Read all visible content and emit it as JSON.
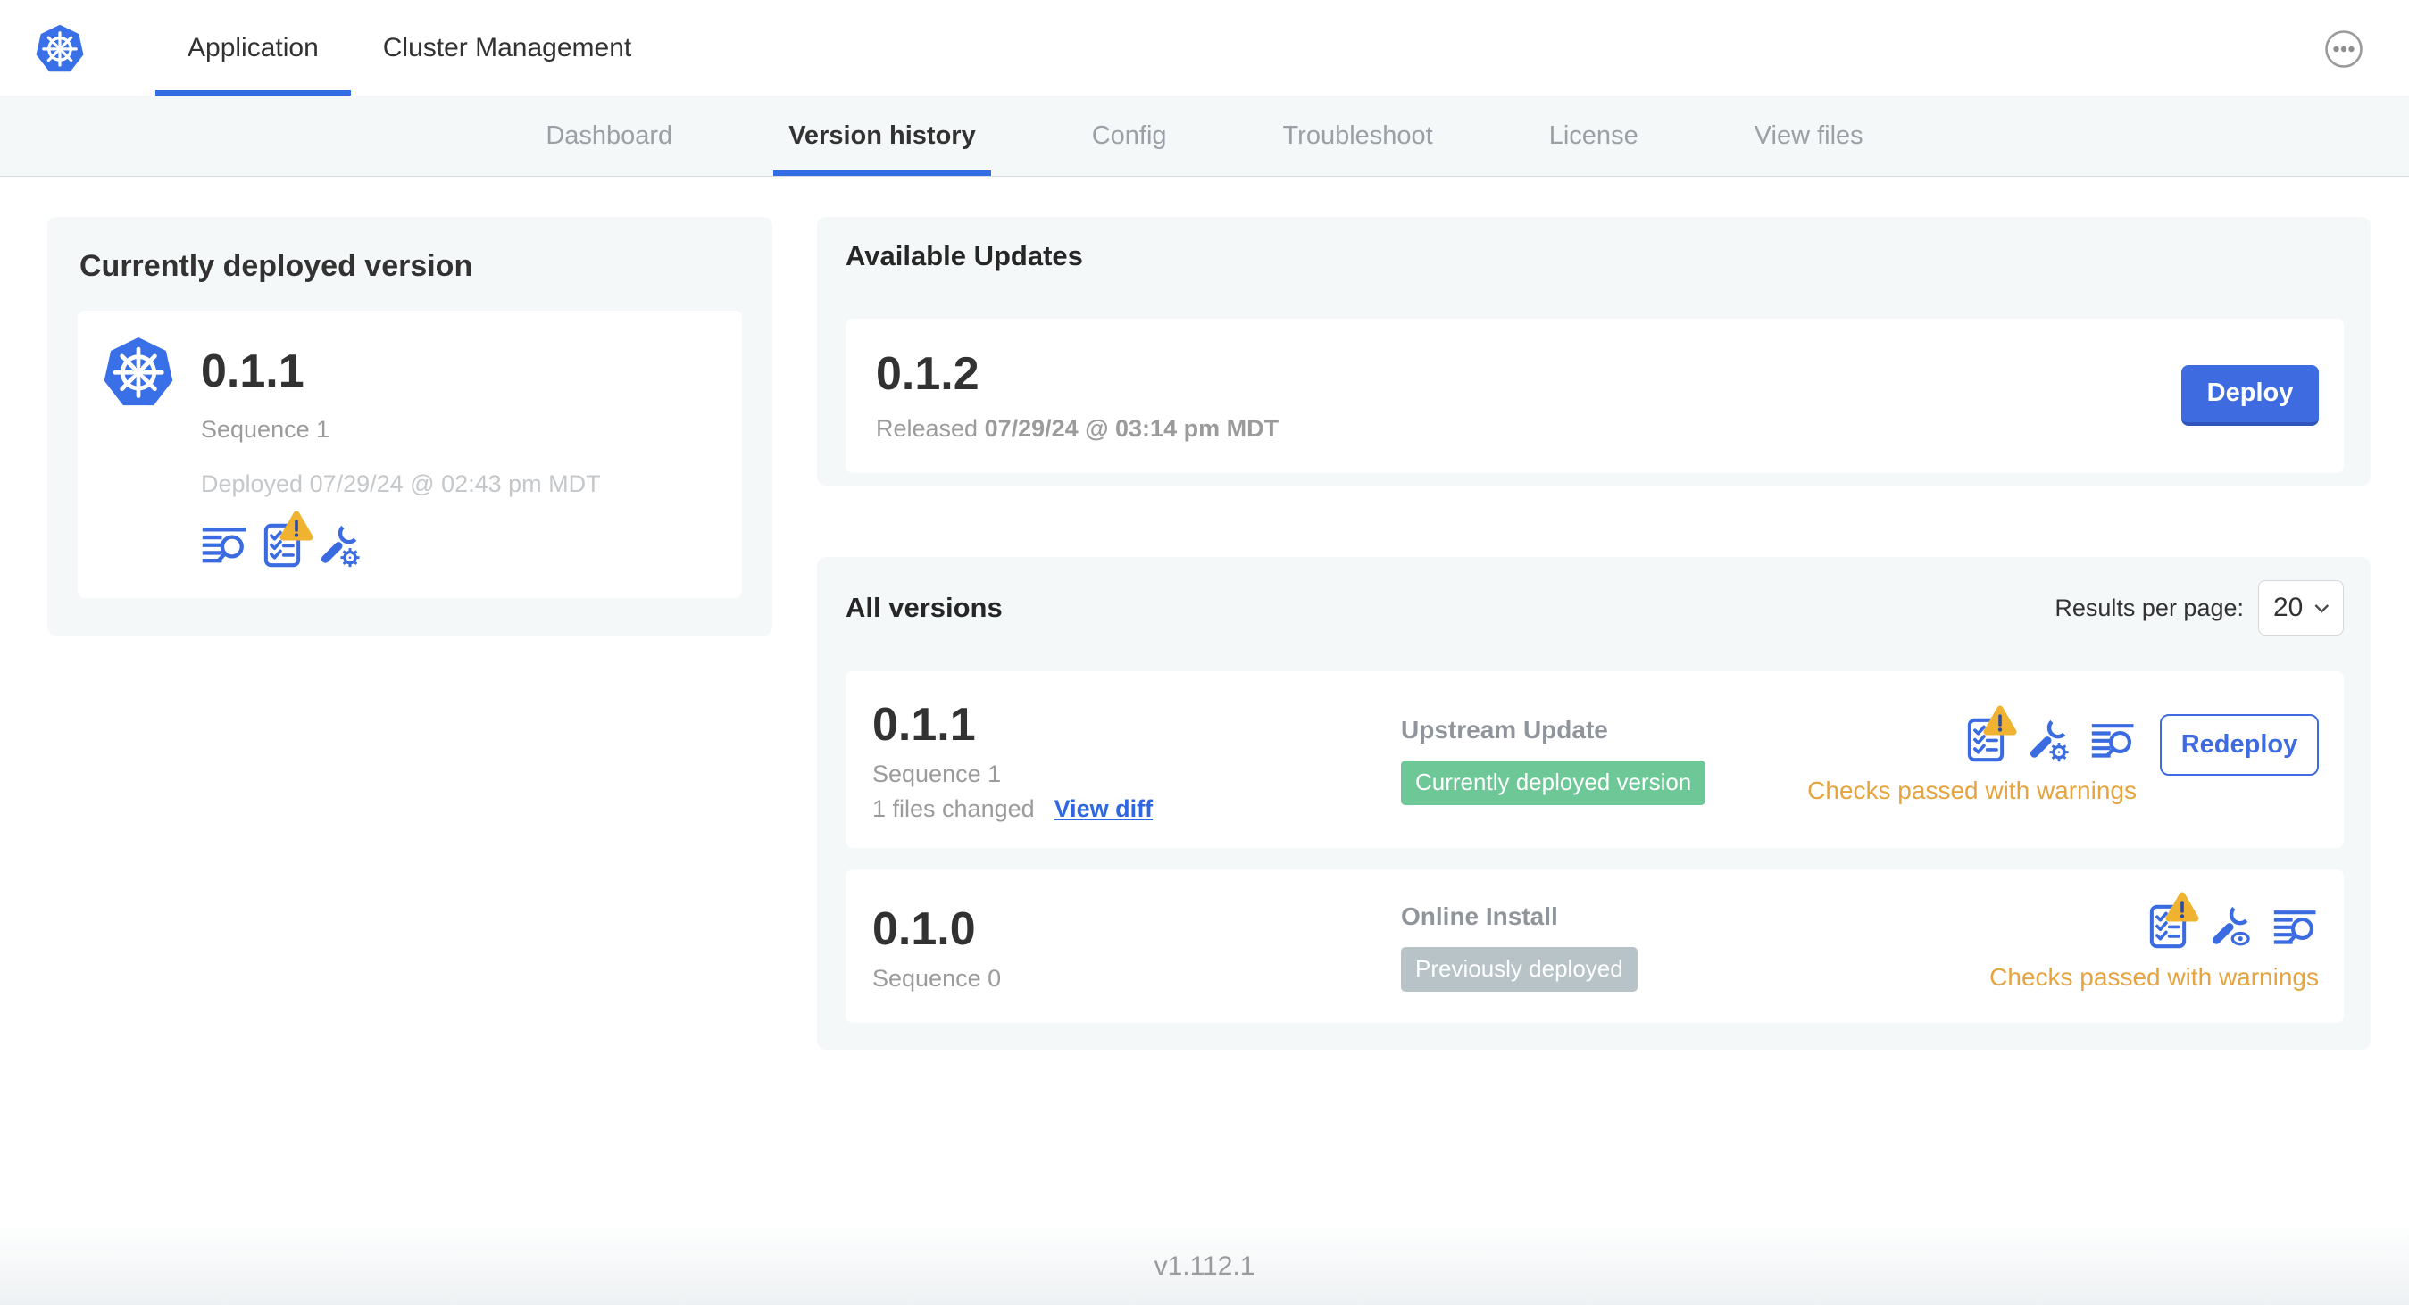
{
  "topnav": {
    "application_tab": "Application",
    "cluster_management_tab": "Cluster Management"
  },
  "subnav": {
    "tabs": [
      "Dashboard",
      "Version history",
      "Config",
      "Troubleshoot",
      "License",
      "View files"
    ],
    "active_tab": "Version history"
  },
  "currently_deployed": {
    "title": "Currently deployed version",
    "version": "0.1.1",
    "sequence": "Sequence 1",
    "deployed": "Deployed 07/29/24 @ 02:43 pm MDT"
  },
  "available_updates": {
    "title": "Available Updates",
    "version": "0.1.2",
    "released_prefix": "Released",
    "released_date": "07/29/24 @ 03:14 pm MDT",
    "deploy_label": "Deploy"
  },
  "all_versions": {
    "title": "All versions",
    "results_per_page_label": "Results per page:",
    "results_per_page": "20",
    "rows": [
      {
        "version": "0.1.1",
        "sequence": "Sequence 1",
        "files_changed": "1 files changed",
        "view_diff_label": "View diff",
        "source": "Upstream Update",
        "badge_label": "Currently deployed version",
        "badge_color": "#6ec796",
        "checks_status": "Checks passed with warnings",
        "action_label": "Redeploy"
      },
      {
        "version": "0.1.0",
        "sequence": "Sequence 0",
        "source": "Online Install",
        "badge_label": "Previously deployed",
        "badge_color": "#b7c3c7",
        "checks_status": "Checks passed with warnings"
      }
    ]
  },
  "footer": {
    "app_version": "v1.112.1"
  },
  "colors": {
    "primary_blue": "#326de6",
    "button_blue": "#3e6be0",
    "warning_orange": "#e5a43f",
    "warning_triangle": "#f0b231",
    "badge_green": "#6ec796",
    "badge_gray": "#b7c3c7",
    "text_dark": "#323232",
    "text_gray": "#9b9b9b",
    "text_light_gray": "#c5c8cb",
    "panel_gray": "#f5f8f9"
  },
  "icons": {
    "logo": "kubernetes-logo",
    "menu": "ellipsis-menu-icon",
    "logs": "logs-magnifier-icon",
    "preflight": "preflight-checklist-icon",
    "warning": "warning-triangle-icon",
    "config": "wrench-gear-icon",
    "config_view": "wrench-eye-icon",
    "chevron": "chevron-down-icon"
  }
}
